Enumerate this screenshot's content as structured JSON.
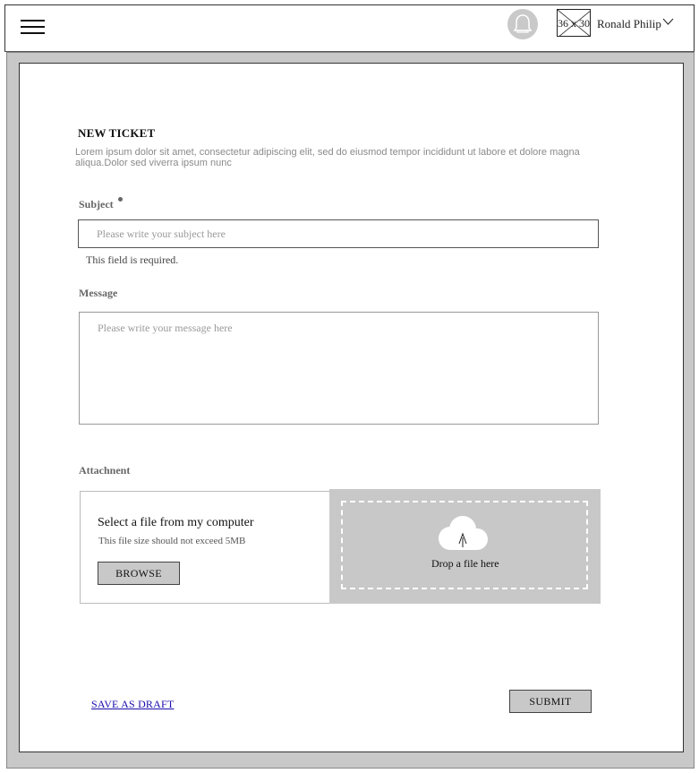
{
  "header": {
    "avatar_placeholder": "36 x 30",
    "user_name": "Ronald Philip"
  },
  "form": {
    "title": "NEW TICKET",
    "description": "Lorem ipsum dolor sit amet, consectetur adipiscing elit, sed do eiusmod tempor incididunt ut labore et dolore magna aliqua.Dolor sed viverra ipsum nunc",
    "subject": {
      "label": "Subject",
      "placeholder": "Please write your subject here",
      "value": "",
      "error": "This field is required."
    },
    "message": {
      "label": "Message",
      "placeholder": "Please write your message here",
      "value": ""
    },
    "attachment": {
      "label": "Attachnent",
      "select_title": "Select a file from my computer",
      "size_note": "This file size should not exceed 5MB",
      "browse_label": "BROWSE",
      "drop_text": "Drop a file here"
    },
    "actions": {
      "draft_label": "SAVE AS DRAFT",
      "submit_label": "SUBMIT"
    }
  },
  "icons": {
    "menu": "hamburger-menu-icon",
    "notifications": "bell-icon",
    "user_menu": "chevron-down-icon",
    "upload": "cloud-upload-icon"
  },
  "colors": {
    "frame_gray": "#c8c8c8",
    "link_blue": "#1a0dab"
  }
}
